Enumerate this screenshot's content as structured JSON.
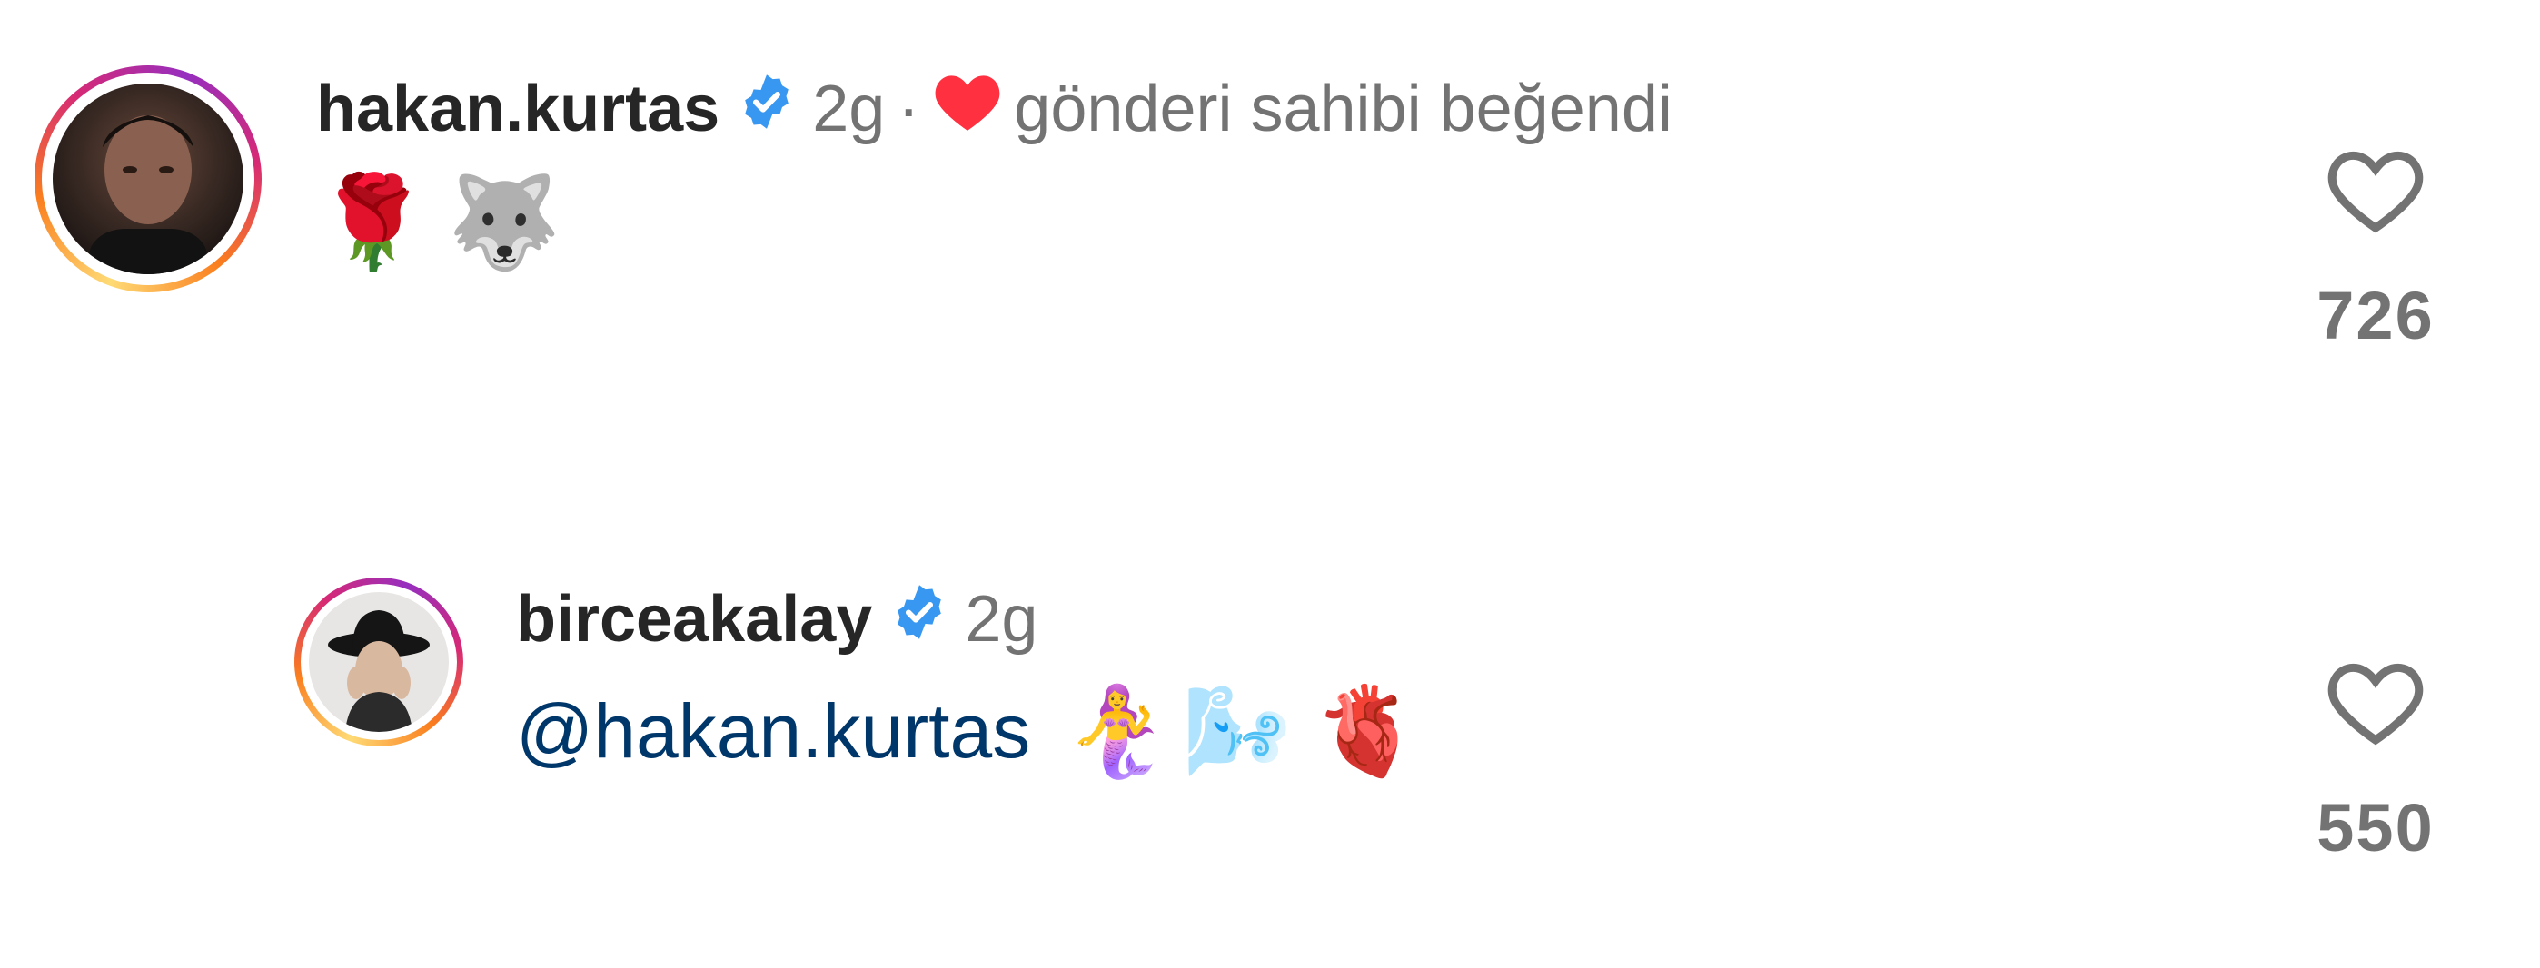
{
  "comments": [
    {
      "username": "hakan.kurtas",
      "time": "2g",
      "separator": "·",
      "liked_text": "gönderi sahibi beğendi",
      "body_emoji": [
        "🌹",
        "🐺"
      ],
      "like_count": "726"
    },
    {
      "username": "birceakalay",
      "time": "2g",
      "mention": "@hakan.kurtas",
      "body_emoji": [
        "🧜‍♀️",
        "🌬️",
        "🫀"
      ],
      "like_count": "550"
    }
  ],
  "icons": {
    "verified": "verified-badge-icon",
    "heart_outline": "heart-outline-icon",
    "heart_filled": "heart-filled-icon"
  },
  "colors": {
    "verified_blue": "#3897f0",
    "liked_red": "#ff3040",
    "mention_blue": "#00376b",
    "meta_gray": "#737373"
  }
}
